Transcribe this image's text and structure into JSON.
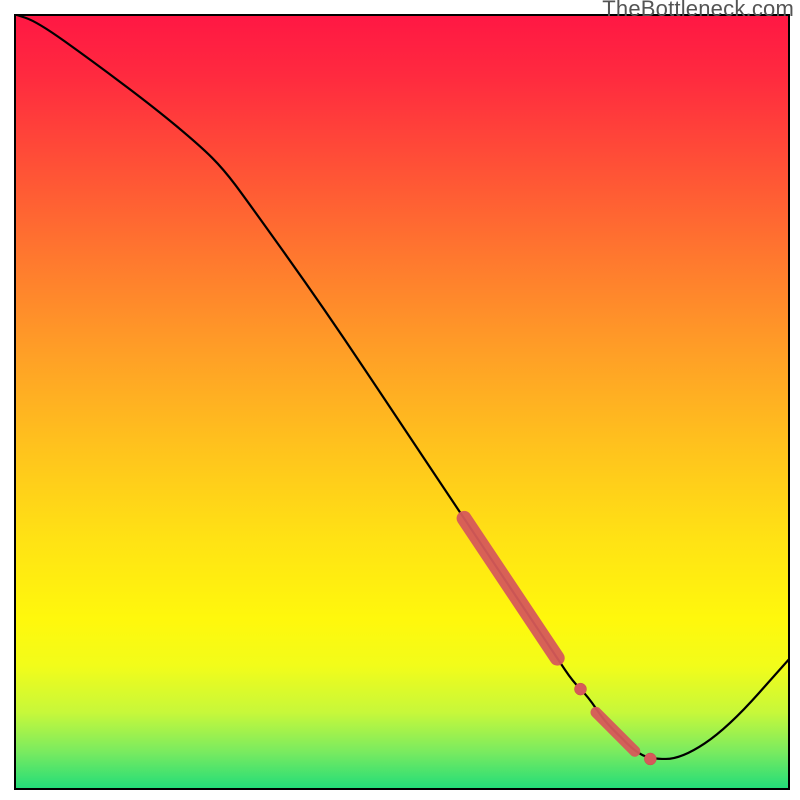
{
  "watermark": "TheBottleneck.com",
  "colors": {
    "frame": "#000000",
    "curve_stroke": "#000000",
    "marker_fill": "#d65a5a",
    "marker_stroke": "#c74e4e"
  },
  "chart_data": {
    "type": "line",
    "title": "",
    "xlabel": "",
    "ylabel": "",
    "xlim": [
      0,
      100
    ],
    "ylim": [
      0,
      100
    ],
    "grid": false,
    "legend": false,
    "x": [
      0,
      3,
      10,
      18,
      24,
      27,
      30,
      40,
      50,
      58,
      62,
      66,
      70,
      72,
      74,
      76,
      78,
      80,
      82,
      86,
      92,
      100
    ],
    "values": [
      100,
      99,
      94,
      88,
      83,
      80,
      76,
      62,
      47,
      35,
      29,
      23,
      17,
      14,
      12,
      9,
      7,
      5,
      4,
      4,
      8,
      17
    ],
    "highlight_segments": [
      {
        "x0": 58,
        "y0": 35,
        "x1": 70,
        "y1": 17,
        "thickness": "thick"
      },
      {
        "x0": 72,
        "y0": 14,
        "x1": 74,
        "y1": 12,
        "thickness": "dot"
      },
      {
        "x0": 75,
        "y0": 10,
        "x1": 80,
        "y1": 5,
        "thickness": "medium"
      },
      {
        "x0": 82,
        "y0": 4,
        "x1": 82,
        "y1": 4,
        "thickness": "dot"
      }
    ]
  }
}
